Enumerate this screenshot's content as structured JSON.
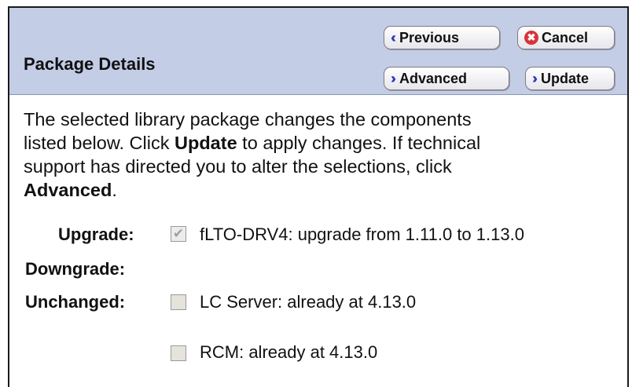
{
  "header": {
    "title": "Package Details"
  },
  "buttons": {
    "previous": "Previous",
    "cancel": "Cancel",
    "advanced": "Advanced",
    "update": "Update"
  },
  "description": {
    "line1": "The selected library package changes the components",
    "line2a": "listed below. Click ",
    "line2b": "Update",
    "line2c": " to apply changes. If technical",
    "line3": "support has directed you to alter the selections, click",
    "line4a": "Advanced",
    "line4b": "."
  },
  "sections": {
    "upgrade_label": "Upgrade:",
    "downgrade_label": "Downgrade:",
    "unchanged_label": "Unchanged:"
  },
  "components": [
    {
      "text": "fLTO-DRV4: upgrade from 1.11.0 to 1.13.0",
      "checked": true,
      "disabled": true
    },
    {
      "text": "LC Server: already at 4.13.0",
      "checked": false,
      "disabled": true
    },
    {
      "text": "RCM: already at 4.13.0",
      "checked": false,
      "disabled": true
    }
  ],
  "icons": {
    "previous": "double-chevron-left-icon",
    "cancel": "cancel-x-icon",
    "advanced": "double-chevron-right-icon",
    "update": "double-chevron-right-icon"
  },
  "colors": {
    "header_bg": "#c4cde6",
    "chevron": "#2e3fb5",
    "cancel_icon": "#d8333a"
  }
}
